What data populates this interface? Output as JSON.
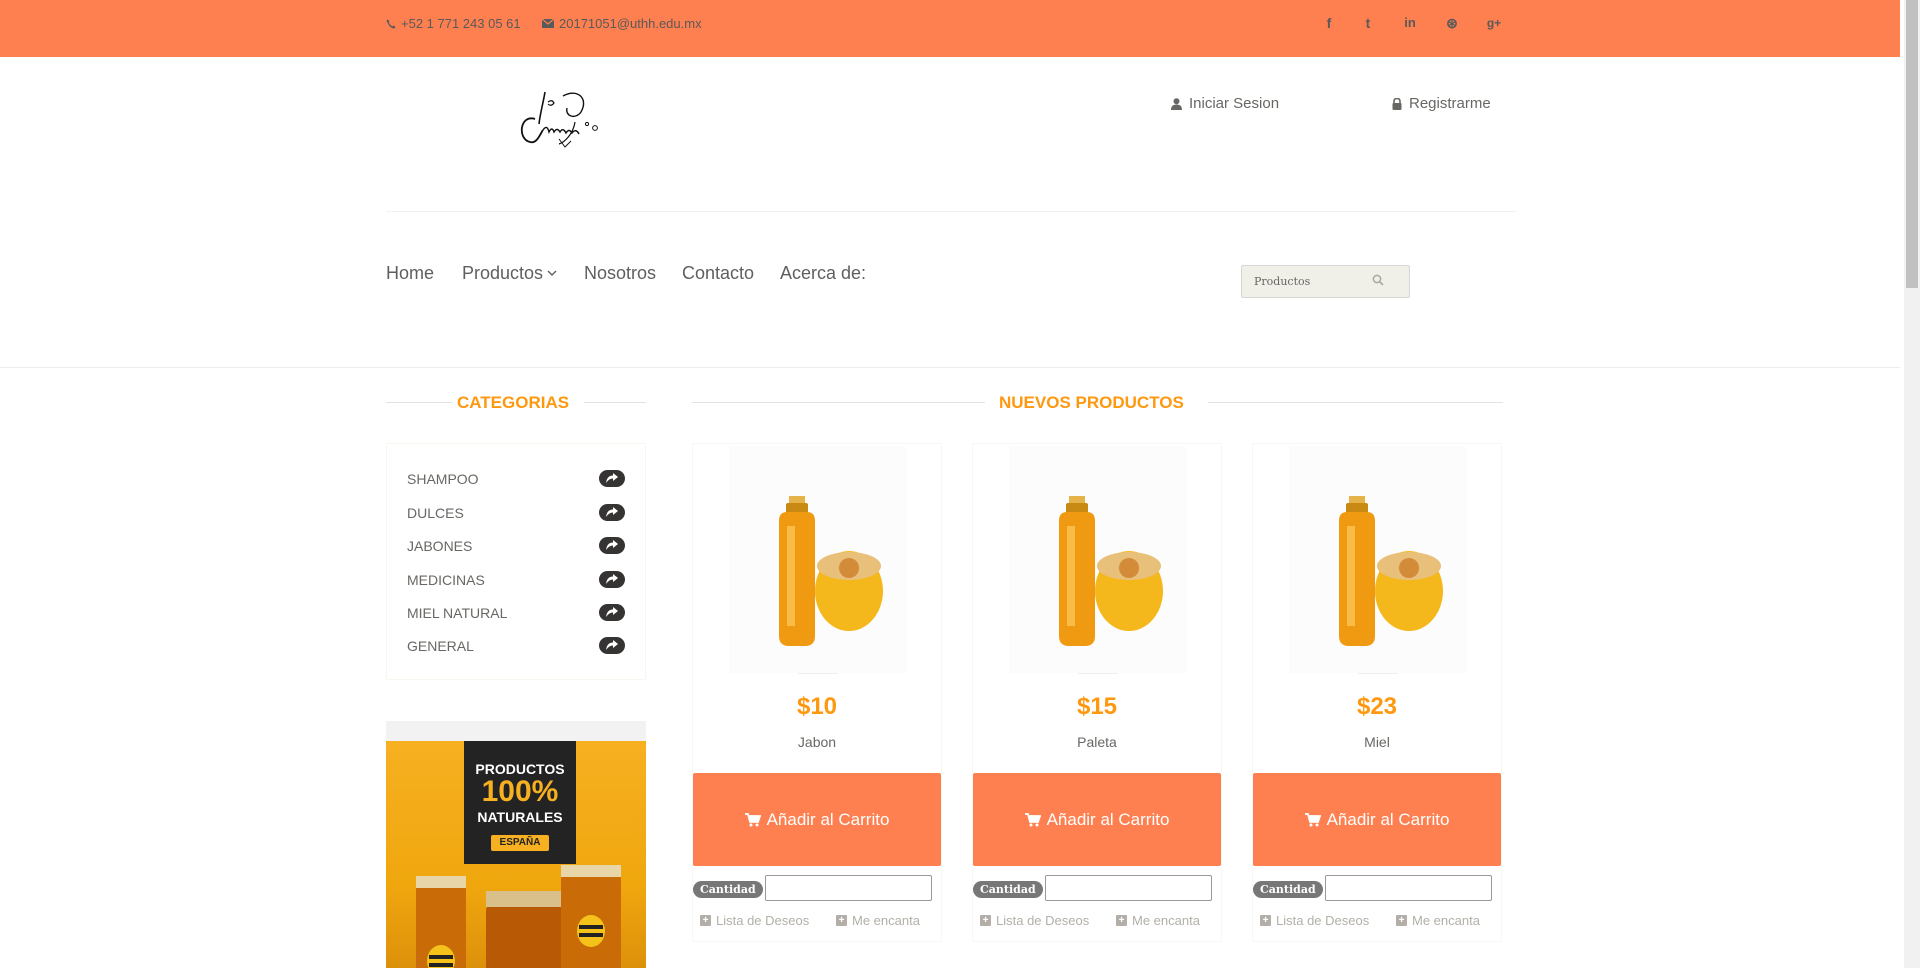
{
  "topbar": {
    "phone": "+52 1 771 243 05 61",
    "email": "20171051@uthh.edu.mx",
    "social": [
      {
        "name": "facebook-icon",
        "glyph": "f"
      },
      {
        "name": "twitter-icon",
        "glyph": "t"
      },
      {
        "name": "linkedin-icon",
        "glyph": "in"
      },
      {
        "name": "dribbble-icon",
        "glyph": "⊛"
      },
      {
        "name": "google-plus-icon",
        "glyph": "g+"
      }
    ]
  },
  "header": {
    "login": "Iniciar Sesion",
    "register": "Registrarme"
  },
  "nav": {
    "home": "Home",
    "products": "Productos",
    "about_us": "Nosotros",
    "contact": "Contacto",
    "about": "Acerca de:",
    "search_placeholder": "Productos"
  },
  "sidebar": {
    "title": "CATEGORIAS",
    "categories": [
      "SHAMPOO",
      "DULCES",
      "JABONES",
      "MEDICINAS",
      "MIEL NATURAL",
      "GENERAL"
    ],
    "banner": {
      "line1": "PRODUCTOS",
      "line2": "100%",
      "line3": "NATURALES",
      "badge": "ESPAÑA"
    }
  },
  "products_section": {
    "title": "NUEVOS PRODUCTOS",
    "add_to_cart": "Añadir al Carrito",
    "quantity_label": "Cantidad",
    "wishlist": "Lista de Deseos",
    "love": "Me encanta",
    "items": [
      {
        "price": "$10",
        "name": "Jabon"
      },
      {
        "price": "$15",
        "name": "Paleta"
      },
      {
        "price": "$23",
        "name": "Miel"
      }
    ]
  },
  "colors": {
    "accent": "#fe7f4f",
    "price": "#fe980f"
  }
}
